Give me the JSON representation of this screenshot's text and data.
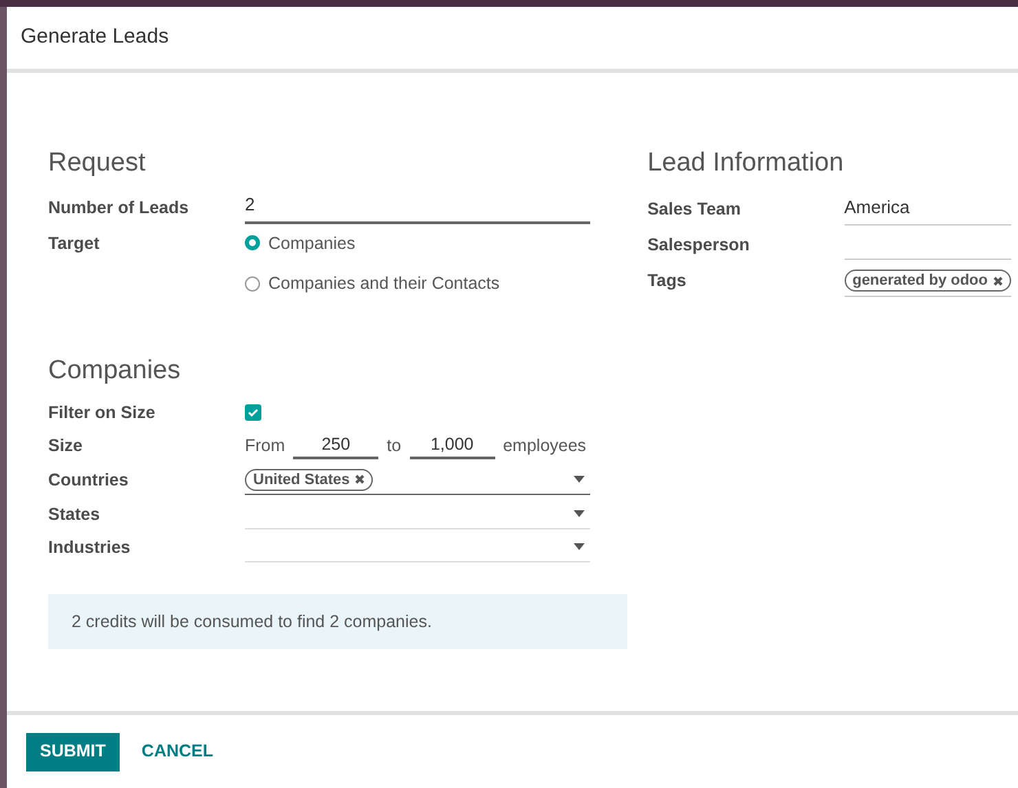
{
  "dialog": {
    "title": "Generate Leads"
  },
  "request": {
    "heading": "Request",
    "number_of_leads": {
      "label": "Number of Leads",
      "value": "2"
    },
    "target": {
      "label": "Target",
      "options": [
        {
          "label": "Companies",
          "selected": true
        },
        {
          "label": "Companies and their Contacts",
          "selected": false
        }
      ]
    }
  },
  "lead_information": {
    "heading": "Lead Information",
    "sales_team": {
      "label": "Sales Team",
      "value": "America"
    },
    "salesperson": {
      "label": "Salesperson"
    },
    "tags": {
      "label": "Tags",
      "tags": [
        "generated by odoo"
      ]
    }
  },
  "companies": {
    "heading": "Companies",
    "filter_on_size": {
      "label": "Filter on Size",
      "checked": true
    },
    "size": {
      "label": "Size",
      "from_label": "From",
      "from": "250",
      "to_label": "to",
      "to": "1,000",
      "unit": "employees"
    },
    "countries": {
      "label": "Countries",
      "tags": [
        "United States"
      ]
    },
    "states": {
      "label": "States"
    },
    "industries": {
      "label": "Industries"
    }
  },
  "info": "2 credits will be consumed to find 2 companies.",
  "buttons": {
    "submit": "SUBMIT",
    "cancel": "CANCEL"
  }
}
